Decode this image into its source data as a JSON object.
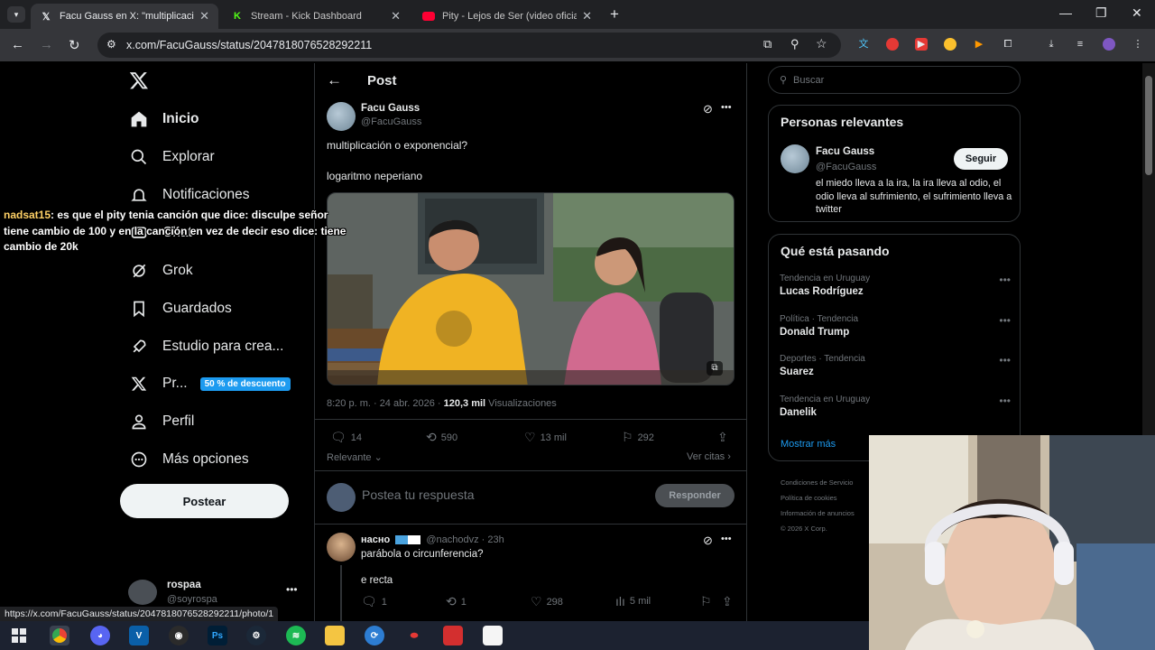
{
  "browser": {
    "tabs": [
      {
        "title": "Facu Gauss en X: \"multiplicació",
        "active": true,
        "icon": "x-logo-icon"
      },
      {
        "title": "Stream - Kick Dashboard",
        "active": false,
        "icon": "kick-icon"
      },
      {
        "title": "Pity - Lejos de Ser (video oficial",
        "active": false,
        "icon": "youtube-icon"
      }
    ],
    "url": "x.com/FacuGauss/status/2047818076528292211",
    "status_url": "https://x.com/FacuGauss/status/2047818076528292211/photo/1"
  },
  "nav": {
    "items": [
      {
        "label": "Inicio",
        "icon": "home-icon"
      },
      {
        "label": "Explorar",
        "icon": "search-icon"
      },
      {
        "label": "Notificaciones",
        "icon": "bell-icon"
      },
      {
        "label": "Chat",
        "icon": "chat-icon"
      },
      {
        "label": "Grok",
        "icon": "grok-icon"
      },
      {
        "label": "Guardados",
        "icon": "bookmark-icon"
      },
      {
        "label": "Estudio para crea...",
        "icon": "rocket-icon"
      },
      {
        "label": "Pr...",
        "icon": "x-premium-icon"
      },
      {
        "label": "Perfil",
        "icon": "person-icon"
      },
      {
        "label": "Más opciones",
        "icon": "more-circle-icon"
      }
    ],
    "premium_badge": "50 % de descuento",
    "post_button": "Postear",
    "account": {
      "name": "rospaa",
      "handle": "@soyrospa"
    }
  },
  "chat_overlay": {
    "user": "nadsat15",
    "message": ": es que el pity tenia canción que dice: disculpe señor tiene cambio de 100 y en la canción en vez de decir eso dice: tiene cambio de 20k"
  },
  "post": {
    "header_title": "Post",
    "author_name": "Facu Gauss",
    "author_handle": "@FacuGauss",
    "text_line1": "multiplicación o exponencial?",
    "text_line2": "logaritmo neperiano",
    "time": "8:20 p. m. · 24 abr. 2026 · ",
    "views_count": "120,3 mil",
    "views_label": " Visualizaciones",
    "replies": "14",
    "reposts": "590",
    "likes": "13 mil",
    "bookmarks": "292",
    "sort_label": "Relevante",
    "quotes_label": "Ver citas",
    "reply_placeholder": "Postea tu respuesta",
    "reply_button": "Responder"
  },
  "reply": {
    "author_name": "насно",
    "author_handle": "@nachodvz · 23h",
    "line1": "parábola o circunferencia?",
    "line2": "e recta",
    "replies": "1",
    "reposts": "1",
    "likes": "298",
    "views": "5 mil"
  },
  "right": {
    "search_placeholder": "Buscar",
    "relevant_title": "Personas relevantes",
    "relevant_name": "Facu Gauss",
    "relevant_handle": "@FacuGauss",
    "follow_button": "Seguir",
    "relevant_bio": "el miedo lleva a la ira, la ira lleva al odio, el odio lleva al sufrimiento, el sufrimiento lleva a twitter",
    "trends_title": "Qué está pasando",
    "trends": [
      {
        "category": "Tendencia en Uruguay",
        "name": "Lucas Rodríguez"
      },
      {
        "category": "Política · Tendencia",
        "name": "Donald Trump"
      },
      {
        "category": "Deportes · Tendencia",
        "name": "Suarez"
      },
      {
        "category": "Tendencia en Uruguay",
        "name": "Danelik"
      }
    ],
    "show_more": "Mostrar más",
    "footer": [
      "Condiciones de Servicio",
      "Política de cookies",
      "Información de anuncios",
      "© 2026 X Corp."
    ]
  },
  "colors": {
    "accent": "#1d9bf0",
    "bg": "#000000",
    "border": "#2f3336",
    "muted": "#71767b"
  }
}
